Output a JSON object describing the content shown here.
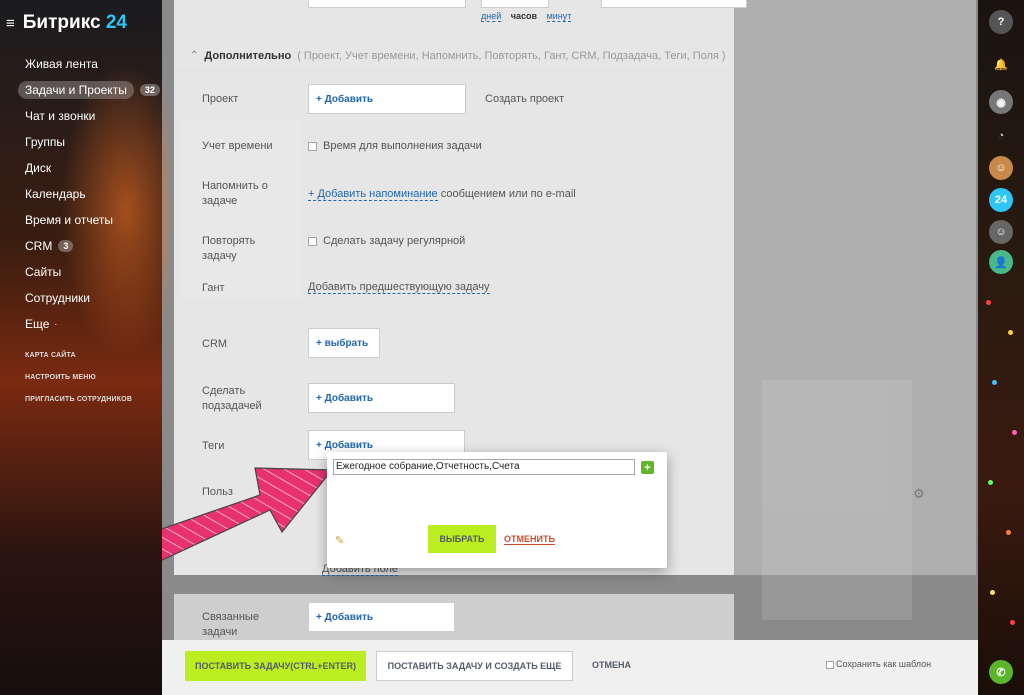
{
  "app": {
    "logo_text": "Битрикс",
    "logo_num": "24"
  },
  "sidebar": {
    "items": [
      {
        "label": "Живая лента"
      },
      {
        "label": "Задачи и Проекты",
        "badge": "32"
      },
      {
        "label": "Чат и звонки"
      },
      {
        "label": "Группы"
      },
      {
        "label": "Диск"
      },
      {
        "label": "Календарь"
      },
      {
        "label": "Время и отчеты"
      },
      {
        "label": "CRM",
        "badge": "3"
      },
      {
        "label": "Сайты"
      },
      {
        "label": "Сотрудники"
      },
      {
        "label": "Еще"
      }
    ],
    "small_links": [
      "КАРТА САЙТА",
      "НАСТРОИТЬ МЕНЮ",
      "ПРИГЛАСИТЬ СОТРУДНИКОВ"
    ]
  },
  "time_units": {
    "days": "дней",
    "hours": "часов",
    "minutes": "минут"
  },
  "section": {
    "title": "Дополнительно",
    "subtitle": "( Проект,  Учет времени,  Напомнить,  Повторять,  Гант,  CRM,  Подзадача,  Теги,  Поля )"
  },
  "fields": {
    "project": {
      "label": "Проект",
      "button": "+ Добавить",
      "link": "Создать проект"
    },
    "time_tracking": {
      "label": "Учет времени",
      "option": "Время для выполнения задачи"
    },
    "remind": {
      "label": "Напомнить о задаче",
      "link": "+ Добавить напоминание",
      "suffix": "сообщением или по e-mail"
    },
    "repeat": {
      "label": "Повторять задачу",
      "option": "Сделать задачу регулярной"
    },
    "gantt": {
      "label": "Гант",
      "link": "Добавить предшествующую задачу"
    },
    "crm": {
      "label": "CRM",
      "button": "+  выбрать"
    },
    "subtask": {
      "label": "Сделать подзадачей",
      "button": "+ Добавить"
    },
    "tags": {
      "label": "Теги",
      "button": "+ Добавить"
    },
    "partial_label": "Польз",
    "add_field": "Добавить поле",
    "related": {
      "label": "Связанные задачи",
      "button": "+ Добавить"
    }
  },
  "popup": {
    "tag_value": "Ежегодное собрание,Отчетность,Счета",
    "select": "ВЫБРАТЬ",
    "cancel": "ОТМЕНИТЬ"
  },
  "footer": {
    "primary": "ПОСТАВИТЬ ЗАДАЧУ(CTRL+ENTER)",
    "secondary": "ПОСТАВИТЬ ЗАДАЧУ И СОЗДАТЬ ЕЩЕ",
    "cancel": "ОТМЕНА",
    "save_template": "Сохранить как шаблон"
  },
  "rightbar": {
    "notif_count": "?",
    "b24": "24"
  },
  "colors": {
    "accent_green": "#bbed21",
    "link_blue": "#2067b0",
    "arrow_pink": "#e8316f"
  }
}
